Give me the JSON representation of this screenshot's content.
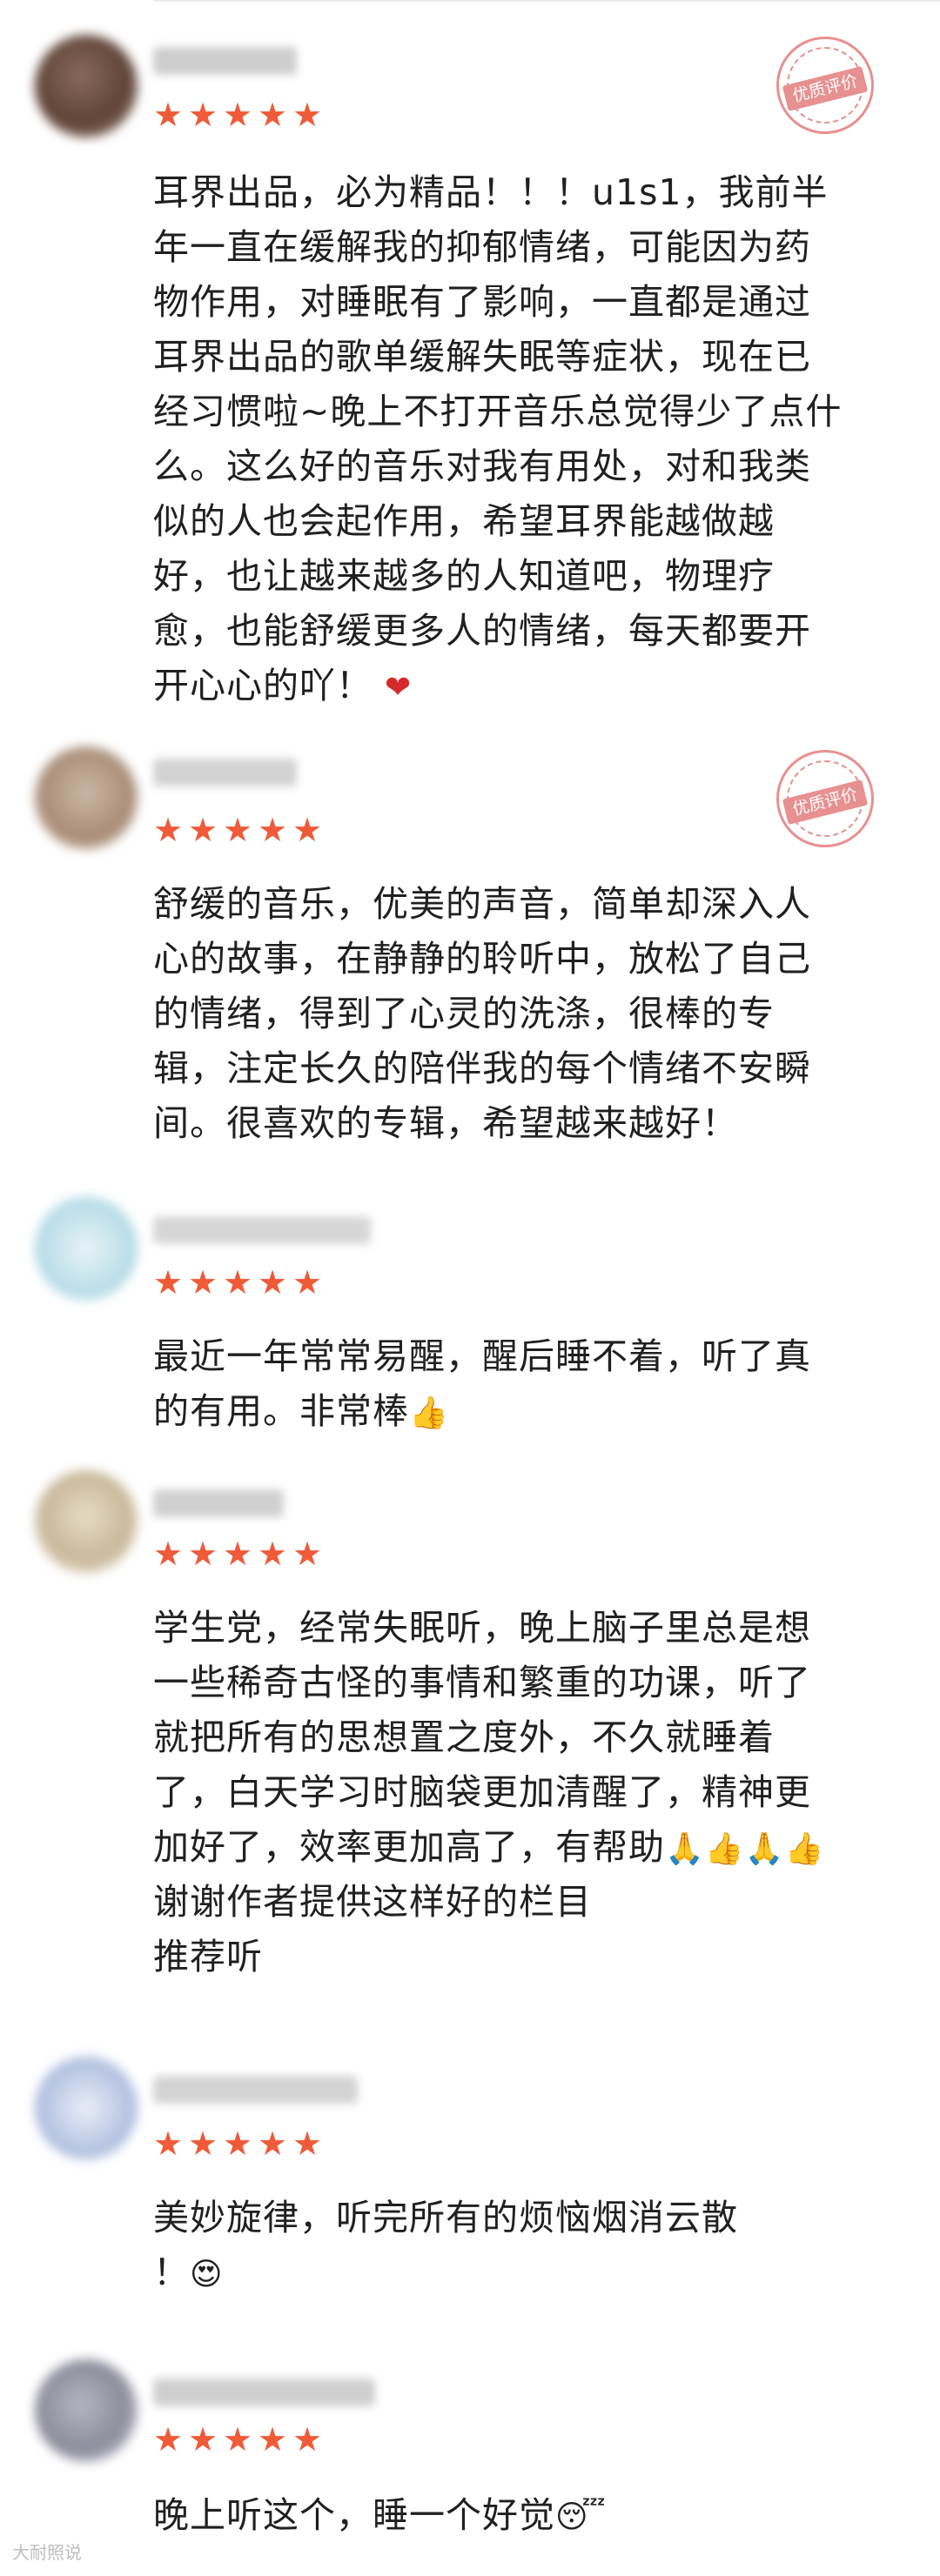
{
  "seal_text": "优质评价",
  "star_icon": "★",
  "star_color": "#ef5a38",
  "seal_color": "#e06b6b",
  "reviews": [
    {
      "rating": 5,
      "text": "耳界出品，必为精品！！！u1s1，我前半\n年一直在缓解我的抑郁情绪，可能因为药\n物作用，对睡眠有了影响，一直都是通过\n耳界出品的歌单缓解失眠等症状，现在已\n经习惯啦~晚上不打开音乐总觉得少了点什\n么。这么好的音乐对我有用处，对和我类\n似的人也会起作用，希望耳界能越做越\n好，也让越来越多的人知道吧，物理疗\n愈，也能舒缓更多人的情绪，每天都要开\n开心心的吖！",
      "emoji": "❤"
    },
    {
      "rating": 5,
      "text": "舒缓的音乐，优美的声音，简单却深入人\n心的故事，在静静的聆听中，放松了自己\n的情绪，得到了心灵的洗涤，很棒的专\n辑，注定长久的陪伴我的每个情绪不安瞬\n间。很喜欢的专辑，希望越来越好！",
      "emoji": ""
    },
    {
      "rating": 5,
      "text": "最近一年常常易醒，醒后睡不着，听了真\n的有用。非常棒",
      "emoji": "👍"
    },
    {
      "rating": 5,
      "text": "学生党，经常失眠听，晚上脑子里总是想\n一些稀奇古怪的事情和繁重的功课，听了\n就把所有的思想置之度外，不久就睡着\n了，白天学习时脑袋更加清醒了，精神更\n加好了，效率更加高了，有帮助",
      "emoji": "🙏👍🙏👍",
      "extra_lines": "谢谢作者提供这样好的栏目\n推荐听"
    },
    {
      "rating": 5,
      "text": "美妙旋律，听完所有的烦恼烟消云散\n！",
      "emoji": "😍"
    },
    {
      "rating": 5,
      "text": "晚上听这个，睡一个好觉",
      "emoji": "😴"
    }
  ],
  "watermark": "大耐照说"
}
